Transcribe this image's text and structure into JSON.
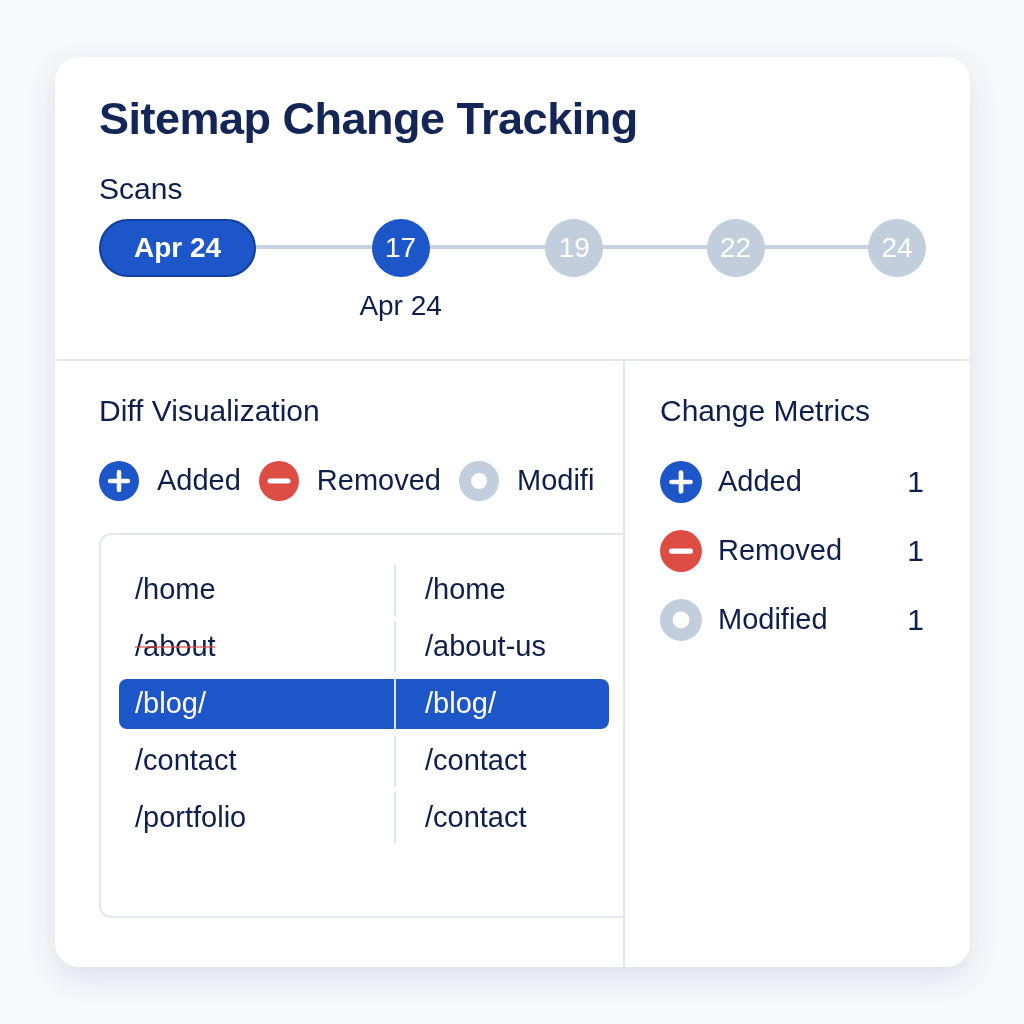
{
  "title": "Sitemap Change Tracking",
  "scans": {
    "label": "Scans",
    "items": [
      {
        "label": "Apr 24",
        "kind": "pill",
        "selected": true
      },
      {
        "label": "17",
        "kind": "dot",
        "selected": true,
        "sublabel": "Apr 24"
      },
      {
        "label": "19",
        "kind": "dot",
        "selected": false
      },
      {
        "label": "22",
        "kind": "dot",
        "selected": false
      },
      {
        "label": "24",
        "kind": "dot",
        "selected": false
      }
    ]
  },
  "diff": {
    "title": "Diff Visualization",
    "legend": [
      {
        "kind": "added",
        "label": "Added"
      },
      {
        "kind": "removed",
        "label": "Removed"
      },
      {
        "kind": "modified",
        "label": "Modifi"
      }
    ],
    "rows": [
      {
        "left": "/home",
        "right": "/home",
        "removed": false,
        "selected": false
      },
      {
        "left": "/about",
        "right": "/about-us",
        "removed": true,
        "selected": false
      },
      {
        "left": "/blog/",
        "right": "/blog/",
        "removed": false,
        "selected": true
      },
      {
        "left": "/contact",
        "right": "/contact",
        "removed": false,
        "selected": false
      },
      {
        "left": "/portfolio",
        "right": "/contact",
        "removed": false,
        "selected": false
      }
    ]
  },
  "metrics": {
    "title": "Change Metrics",
    "items": [
      {
        "kind": "added",
        "label": "Added",
        "value": "1"
      },
      {
        "kind": "removed",
        "label": "Removed",
        "value": "1"
      },
      {
        "kind": "modified",
        "label": "Modified",
        "value": "1"
      }
    ]
  }
}
